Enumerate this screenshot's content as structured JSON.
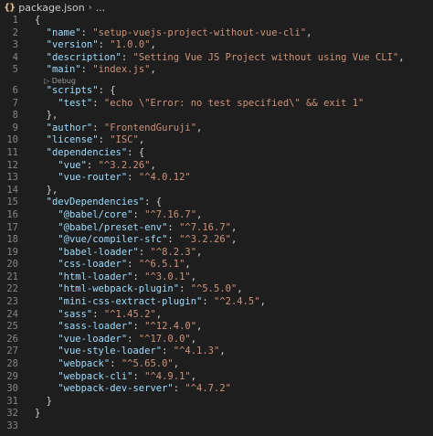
{
  "breadcrumb": {
    "icon_text": "{}",
    "file": "package.json",
    "more": "..."
  },
  "codelens": {
    "debug_label": "Debug",
    "after_line": 5
  },
  "lines": [
    {
      "num": "1",
      "segs": [
        {
          "t": "{",
          "c": "p"
        }
      ]
    },
    {
      "num": "2",
      "segs": [
        {
          "t": "  ",
          "c": "p"
        },
        {
          "t": "\"name\"",
          "c": "k"
        },
        {
          "t": ": ",
          "c": "p"
        },
        {
          "t": "\"setup-vuejs-project-without-vue-cli\"",
          "c": "s"
        },
        {
          "t": ",",
          "c": "p"
        }
      ]
    },
    {
      "num": "3",
      "segs": [
        {
          "t": "  ",
          "c": "p"
        },
        {
          "t": "\"version\"",
          "c": "k"
        },
        {
          "t": ": ",
          "c": "p"
        },
        {
          "t": "\"1.0.0\"",
          "c": "s"
        },
        {
          "t": ",",
          "c": "p"
        }
      ]
    },
    {
      "num": "4",
      "segs": [
        {
          "t": "  ",
          "c": "p"
        },
        {
          "t": "\"description\"",
          "c": "k"
        },
        {
          "t": ": ",
          "c": "p"
        },
        {
          "t": "\"Setting Vue JS Project without using Vue CLI\"",
          "c": "s"
        },
        {
          "t": ",",
          "c": "p"
        }
      ]
    },
    {
      "num": "5",
      "segs": [
        {
          "t": "  ",
          "c": "p"
        },
        {
          "t": "\"main\"",
          "c": "k"
        },
        {
          "t": ": ",
          "c": "p"
        },
        {
          "t": "\"index.js\"",
          "c": "s"
        },
        {
          "t": ",",
          "c": "p"
        }
      ]
    },
    {
      "num": "6",
      "segs": [
        {
          "t": "  ",
          "c": "p"
        },
        {
          "t": "\"scripts\"",
          "c": "k"
        },
        {
          "t": ": {",
          "c": "p"
        }
      ]
    },
    {
      "num": "7",
      "segs": [
        {
          "t": "    ",
          "c": "p"
        },
        {
          "t": "\"test\"",
          "c": "k"
        },
        {
          "t": ": ",
          "c": "p"
        },
        {
          "t": "\"echo \\\"Error: no test specified\\\" && exit 1\"",
          "c": "s"
        }
      ]
    },
    {
      "num": "8",
      "segs": [
        {
          "t": "  },",
          "c": "p"
        }
      ]
    },
    {
      "num": "9",
      "segs": [
        {
          "t": "  ",
          "c": "p"
        },
        {
          "t": "\"author\"",
          "c": "k"
        },
        {
          "t": ": ",
          "c": "p"
        },
        {
          "t": "\"FrontendGuruji\"",
          "c": "s"
        },
        {
          "t": ",",
          "c": "p"
        }
      ]
    },
    {
      "num": "10",
      "segs": [
        {
          "t": "  ",
          "c": "p"
        },
        {
          "t": "\"license\"",
          "c": "k"
        },
        {
          "t": ": ",
          "c": "p"
        },
        {
          "t": "\"ISC\"",
          "c": "s"
        },
        {
          "t": ",",
          "c": "p"
        }
      ]
    },
    {
      "num": "11",
      "segs": [
        {
          "t": "  ",
          "c": "p"
        },
        {
          "t": "\"dependencies\"",
          "c": "k"
        },
        {
          "t": ": {",
          "c": "p"
        }
      ]
    },
    {
      "num": "12",
      "segs": [
        {
          "t": "    ",
          "c": "p"
        },
        {
          "t": "\"vue\"",
          "c": "k"
        },
        {
          "t": ": ",
          "c": "p"
        },
        {
          "t": "\"^3.2.26\"",
          "c": "s"
        },
        {
          "t": ",",
          "c": "p"
        }
      ]
    },
    {
      "num": "13",
      "segs": [
        {
          "t": "    ",
          "c": "p"
        },
        {
          "t": "\"vue-router\"",
          "c": "k"
        },
        {
          "t": ": ",
          "c": "p"
        },
        {
          "t": "\"^4.0.12\"",
          "c": "s"
        }
      ]
    },
    {
      "num": "14",
      "segs": [
        {
          "t": "  },",
          "c": "p"
        }
      ]
    },
    {
      "num": "15",
      "segs": [
        {
          "t": "  ",
          "c": "p"
        },
        {
          "t": "\"devDependencies\"",
          "c": "k"
        },
        {
          "t": ": {",
          "c": "p"
        }
      ]
    },
    {
      "num": "16",
      "segs": [
        {
          "t": "    ",
          "c": "p"
        },
        {
          "t": "\"@babel/core\"",
          "c": "k"
        },
        {
          "t": ": ",
          "c": "p"
        },
        {
          "t": "\"^7.16.7\"",
          "c": "s"
        },
        {
          "t": ",",
          "c": "p"
        }
      ]
    },
    {
      "num": "17",
      "segs": [
        {
          "t": "    ",
          "c": "p"
        },
        {
          "t": "\"@babel/preset-env\"",
          "c": "k"
        },
        {
          "t": ": ",
          "c": "p"
        },
        {
          "t": "\"^7.16.7\"",
          "c": "s"
        },
        {
          "t": ",",
          "c": "p"
        }
      ]
    },
    {
      "num": "18",
      "segs": [
        {
          "t": "    ",
          "c": "p"
        },
        {
          "t": "\"@vue/compiler-sfc\"",
          "c": "k"
        },
        {
          "t": ": ",
          "c": "p"
        },
        {
          "t": "\"^3.2.26\"",
          "c": "s"
        },
        {
          "t": ",",
          "c": "p"
        }
      ]
    },
    {
      "num": "19",
      "segs": [
        {
          "t": "    ",
          "c": "p"
        },
        {
          "t": "\"babel-loader\"",
          "c": "k"
        },
        {
          "t": ": ",
          "c": "p"
        },
        {
          "t": "\"^8.2.3\"",
          "c": "s"
        },
        {
          "t": ",",
          "c": "p"
        }
      ]
    },
    {
      "num": "20",
      "segs": [
        {
          "t": "    ",
          "c": "p"
        },
        {
          "t": "\"css-loader\"",
          "c": "k"
        },
        {
          "t": ": ",
          "c": "p"
        },
        {
          "t": "\"^6.5.1\"",
          "c": "s"
        },
        {
          "t": ",",
          "c": "p"
        }
      ]
    },
    {
      "num": "21",
      "segs": [
        {
          "t": "    ",
          "c": "p"
        },
        {
          "t": "\"html-loader\"",
          "c": "k"
        },
        {
          "t": ": ",
          "c": "p"
        },
        {
          "t": "\"^3.0.1\"",
          "c": "s"
        },
        {
          "t": ",",
          "c": "p"
        }
      ]
    },
    {
      "num": "22",
      "segs": [
        {
          "t": "    ",
          "c": "p"
        },
        {
          "t": "\"html-webpack-plugin\"",
          "c": "k"
        },
        {
          "t": ": ",
          "c": "p"
        },
        {
          "t": "\"^5.5.0\"",
          "c": "s"
        },
        {
          "t": ",",
          "c": "p"
        }
      ]
    },
    {
      "num": "23",
      "segs": [
        {
          "t": "    ",
          "c": "p"
        },
        {
          "t": "\"mini-css-extract-plugin\"",
          "c": "k"
        },
        {
          "t": ": ",
          "c": "p"
        },
        {
          "t": "\"^2.4.5\"",
          "c": "s"
        },
        {
          "t": ",",
          "c": "p"
        }
      ]
    },
    {
      "num": "24",
      "segs": [
        {
          "t": "    ",
          "c": "p"
        },
        {
          "t": "\"sass\"",
          "c": "k"
        },
        {
          "t": ": ",
          "c": "p"
        },
        {
          "t": "\"^1.45.2\"",
          "c": "s"
        },
        {
          "t": ",",
          "c": "p"
        }
      ]
    },
    {
      "num": "25",
      "segs": [
        {
          "t": "    ",
          "c": "p"
        },
        {
          "t": "\"sass-loader\"",
          "c": "k"
        },
        {
          "t": ": ",
          "c": "p"
        },
        {
          "t": "\"^12.4.0\"",
          "c": "s"
        },
        {
          "t": ",",
          "c": "p"
        }
      ]
    },
    {
      "num": "26",
      "segs": [
        {
          "t": "    ",
          "c": "p"
        },
        {
          "t": "\"vue-loader\"",
          "c": "k"
        },
        {
          "t": ": ",
          "c": "p"
        },
        {
          "t": "\"^17.0.0\"",
          "c": "s"
        },
        {
          "t": ",",
          "c": "p"
        }
      ]
    },
    {
      "num": "27",
      "segs": [
        {
          "t": "    ",
          "c": "p"
        },
        {
          "t": "\"vue-style-loader\"",
          "c": "k"
        },
        {
          "t": ": ",
          "c": "p"
        },
        {
          "t": "\"^4.1.3\"",
          "c": "s"
        },
        {
          "t": ",",
          "c": "p"
        }
      ]
    },
    {
      "num": "28",
      "segs": [
        {
          "t": "    ",
          "c": "p"
        },
        {
          "t": "\"webpack\"",
          "c": "k"
        },
        {
          "t": ": ",
          "c": "p"
        },
        {
          "t": "\"^5.65.0\"",
          "c": "s"
        },
        {
          "t": ",",
          "c": "p"
        }
      ]
    },
    {
      "num": "29",
      "segs": [
        {
          "t": "    ",
          "c": "p"
        },
        {
          "t": "\"webpack-cli\"",
          "c": "k"
        },
        {
          "t": ": ",
          "c": "p"
        },
        {
          "t": "\"^4.9.1\"",
          "c": "s"
        },
        {
          "t": ",",
          "c": "p"
        }
      ]
    },
    {
      "num": "30",
      "segs": [
        {
          "t": "    ",
          "c": "p"
        },
        {
          "t": "\"webpack-dev-server\"",
          "c": "k"
        },
        {
          "t": ": ",
          "c": "p"
        },
        {
          "t": "\"^4.7.2\"",
          "c": "s"
        }
      ]
    },
    {
      "num": "31",
      "segs": [
        {
          "t": "  }",
          "c": "p"
        }
      ]
    },
    {
      "num": "32",
      "segs": [
        {
          "t": "}",
          "c": "p"
        }
      ]
    },
    {
      "num": "33",
      "segs": []
    }
  ],
  "colors": {
    "background": "#1e1e1e",
    "key": "#9cdcfe",
    "string": "#ce9178",
    "punctuation": "#d4d4d4",
    "line_number": "#858585",
    "json_icon": "#e2c08d"
  }
}
